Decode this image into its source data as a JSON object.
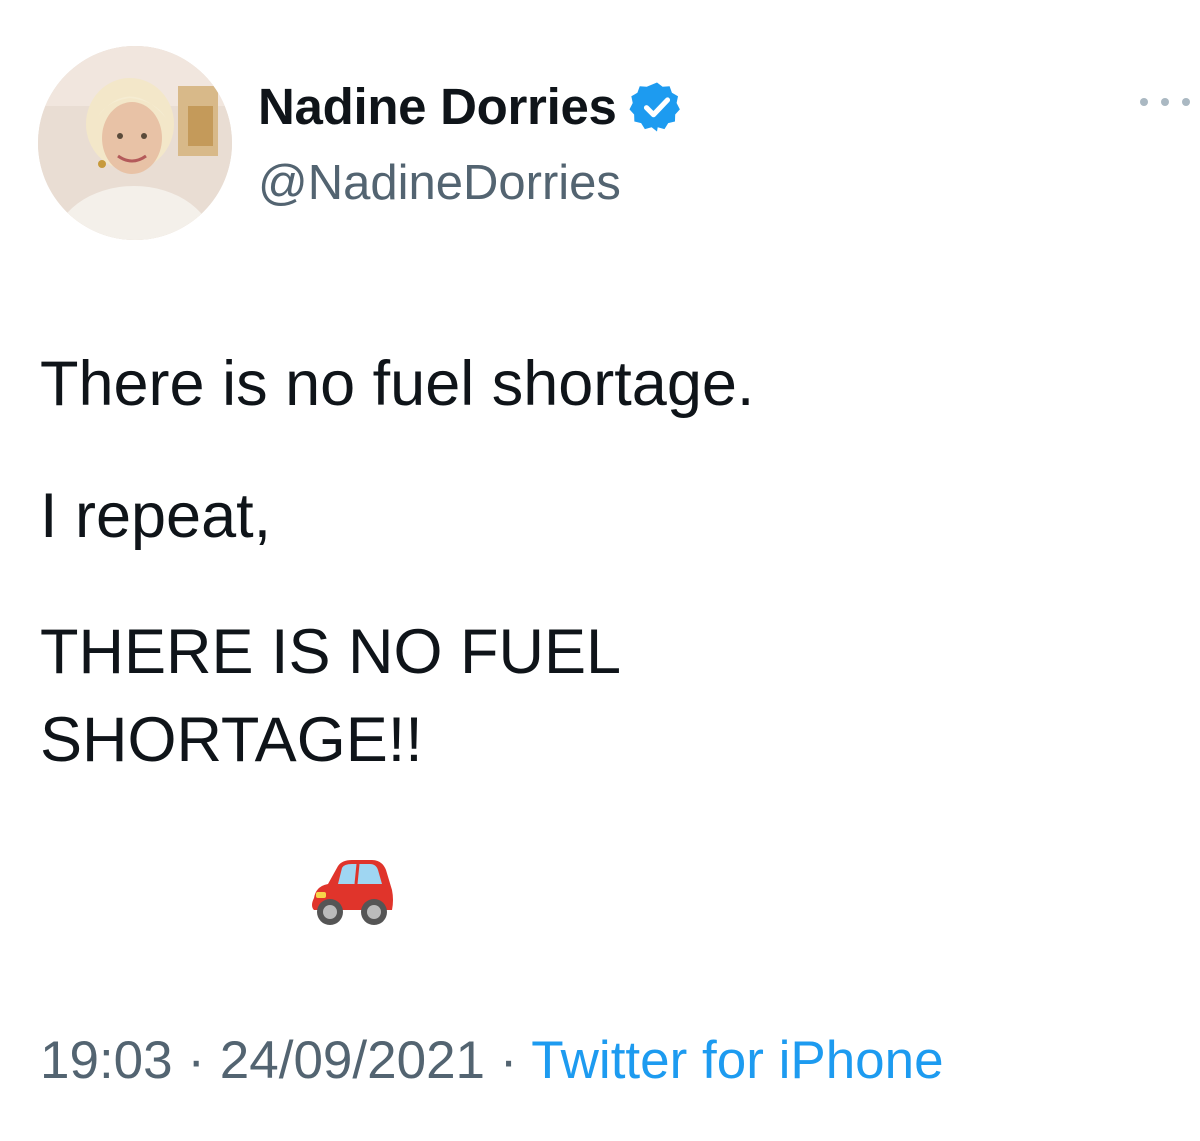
{
  "author": {
    "display_name": "Nadine Dorries",
    "handle": "@NadineDorries",
    "verified_icon": "verified-badge-icon",
    "avatar": "profile-photo"
  },
  "tweet": {
    "lines": [
      "There is no fuel shortage.",
      "I repeat,",
      "THERE IS NO FUEL",
      "SHORTAGE!!"
    ],
    "emoji": "red-car-icon"
  },
  "meta": {
    "time": "19:03",
    "separator": "·",
    "date": "24/09/2021",
    "source": "Twitter for iPhone"
  },
  "colors": {
    "text": "#0f1419",
    "secondary": "#536471",
    "link": "#1d9bf0"
  }
}
